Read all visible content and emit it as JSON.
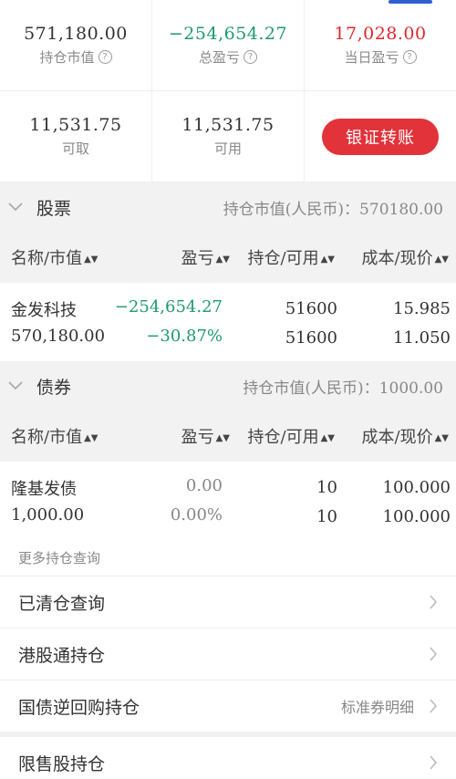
{
  "summary": {
    "market_value": "571,180.00",
    "market_value_label": "持仓市值",
    "total_pl": "−254,654.27",
    "total_pl_label": "总盈亏",
    "today_pl": "17,028.00",
    "today_pl_label": "当日盈亏",
    "withdrawable": "11,531.75",
    "withdrawable_label": "可取",
    "available": "11,531.75",
    "available_label": "可用",
    "transfer_button": "银证转账"
  },
  "sections": [
    {
      "title": "股票",
      "market_value_text": "持仓市值(人民币)：570180.00",
      "columns": [
        "名称/市值",
        "盈亏",
        "持仓/可用",
        "成本/现价"
      ],
      "rows": [
        {
          "name": "金发科技",
          "market_value": "570,180.00",
          "pl_amount": "−254,654.27",
          "pl_percent": "−30.87%",
          "position": "51600",
          "available": "51600",
          "cost": "15.985",
          "price": "11.050"
        }
      ]
    },
    {
      "title": "债券",
      "market_value_text": "持仓市值(人民币)：1000.00",
      "columns": [
        "名称/市值",
        "盈亏",
        "持仓/可用",
        "成本/现价"
      ],
      "rows": [
        {
          "name": "隆基发债",
          "market_value": "1,000.00",
          "pl_amount": "0.00",
          "pl_percent": "0.00%",
          "position": "10",
          "available": "10",
          "cost": "100.000",
          "price": "100.000"
        }
      ]
    }
  ],
  "more": {
    "title": "更多持仓查询",
    "items": [
      {
        "label": "已清仓查询",
        "extra": ""
      },
      {
        "label": "港股通持仓",
        "extra": ""
      },
      {
        "label": "国债逆回购持仓",
        "extra": "标准券明细"
      },
      {
        "label": "限售股持仓",
        "extra": ""
      }
    ]
  },
  "colors": {
    "red": "#e0262b",
    "green": "#1f9a6c",
    "accent": "#2f5fd0",
    "button": "#e2323a"
  }
}
